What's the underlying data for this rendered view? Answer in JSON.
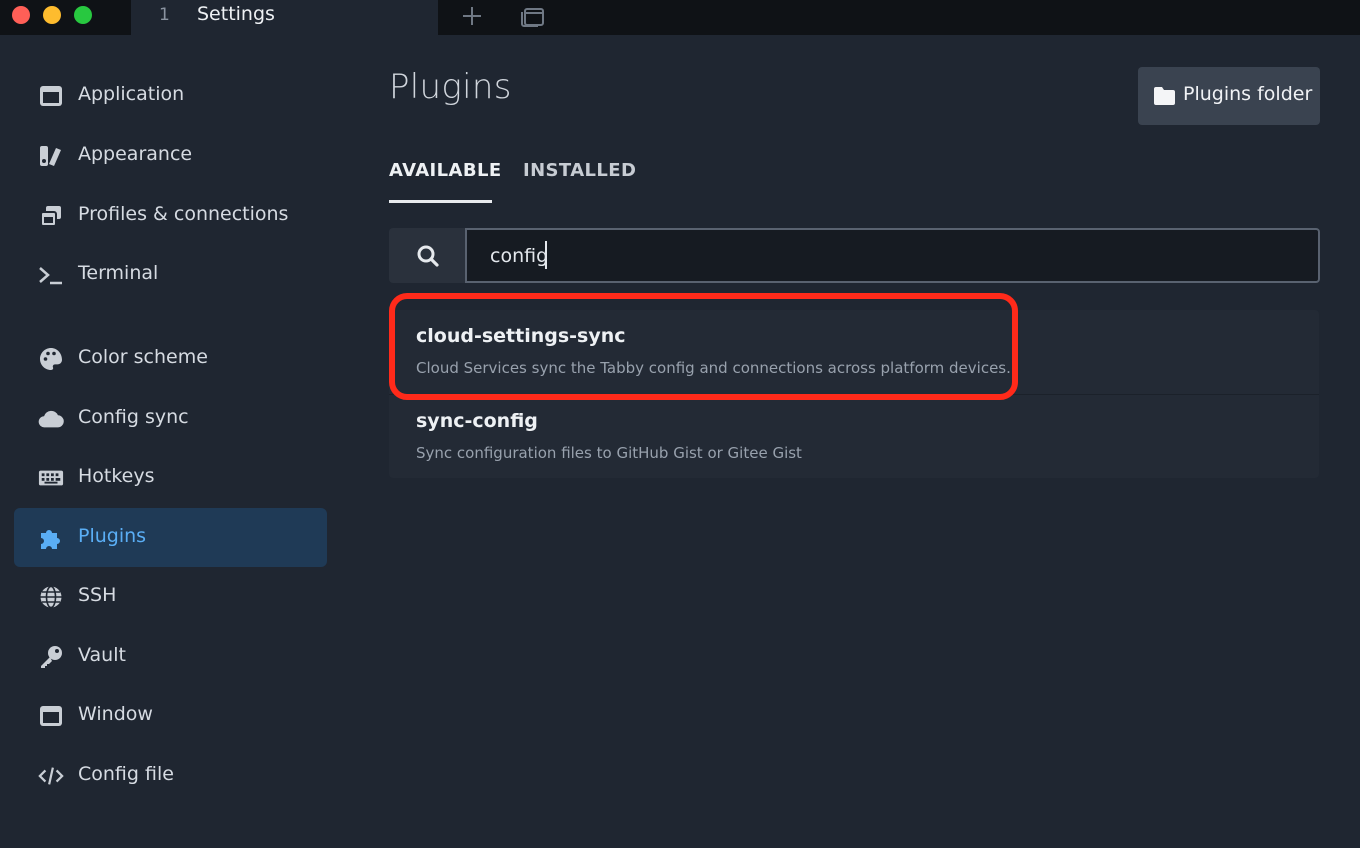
{
  "titlebar": {
    "tab_index": "1",
    "tab_title": "Settings"
  },
  "sidebar": {
    "items": [
      {
        "label": "Application",
        "icon": "application-window-icon"
      },
      {
        "label": "Appearance",
        "icon": "appearance-swatch-icon"
      },
      {
        "label": "Profiles & connections",
        "icon": "profiles-windows-icon"
      },
      {
        "label": "Terminal",
        "icon": "terminal-prompt-icon"
      },
      {
        "label": "Color scheme",
        "icon": "palette-icon"
      },
      {
        "label": "Config sync",
        "icon": "cloud-icon"
      },
      {
        "label": "Hotkeys",
        "icon": "keyboard-icon"
      },
      {
        "label": "Plugins",
        "icon": "puzzle-piece-icon",
        "active": true
      },
      {
        "label": "SSH",
        "icon": "globe-icon"
      },
      {
        "label": "Vault",
        "icon": "key-icon"
      },
      {
        "label": "Window",
        "icon": "window-icon"
      },
      {
        "label": "Config file",
        "icon": "code-icon"
      }
    ]
  },
  "main": {
    "title": "Plugins",
    "folder_button": "Plugins folder",
    "tabs": [
      {
        "label": "AVAILABLE",
        "active": true
      },
      {
        "label": "INSTALLED",
        "active": false
      }
    ],
    "search": {
      "value": "config",
      "icon": "search-icon"
    },
    "results": [
      {
        "name": "cloud-settings-sync",
        "description": "Cloud Services sync the Tabby config and connections across platform devices.",
        "highlighted": true
      },
      {
        "name": "sync-config",
        "description": "Sync configuration files to GitHub Gist or Gitee Gist",
        "highlighted": false
      }
    ]
  },
  "colors": {
    "background": "#1f2631",
    "titlebar": "#0f1216",
    "active_nav_bg": "#1f3a56",
    "active_nav_text": "#5aaef5",
    "highlight_border": "#ff2a1a"
  }
}
